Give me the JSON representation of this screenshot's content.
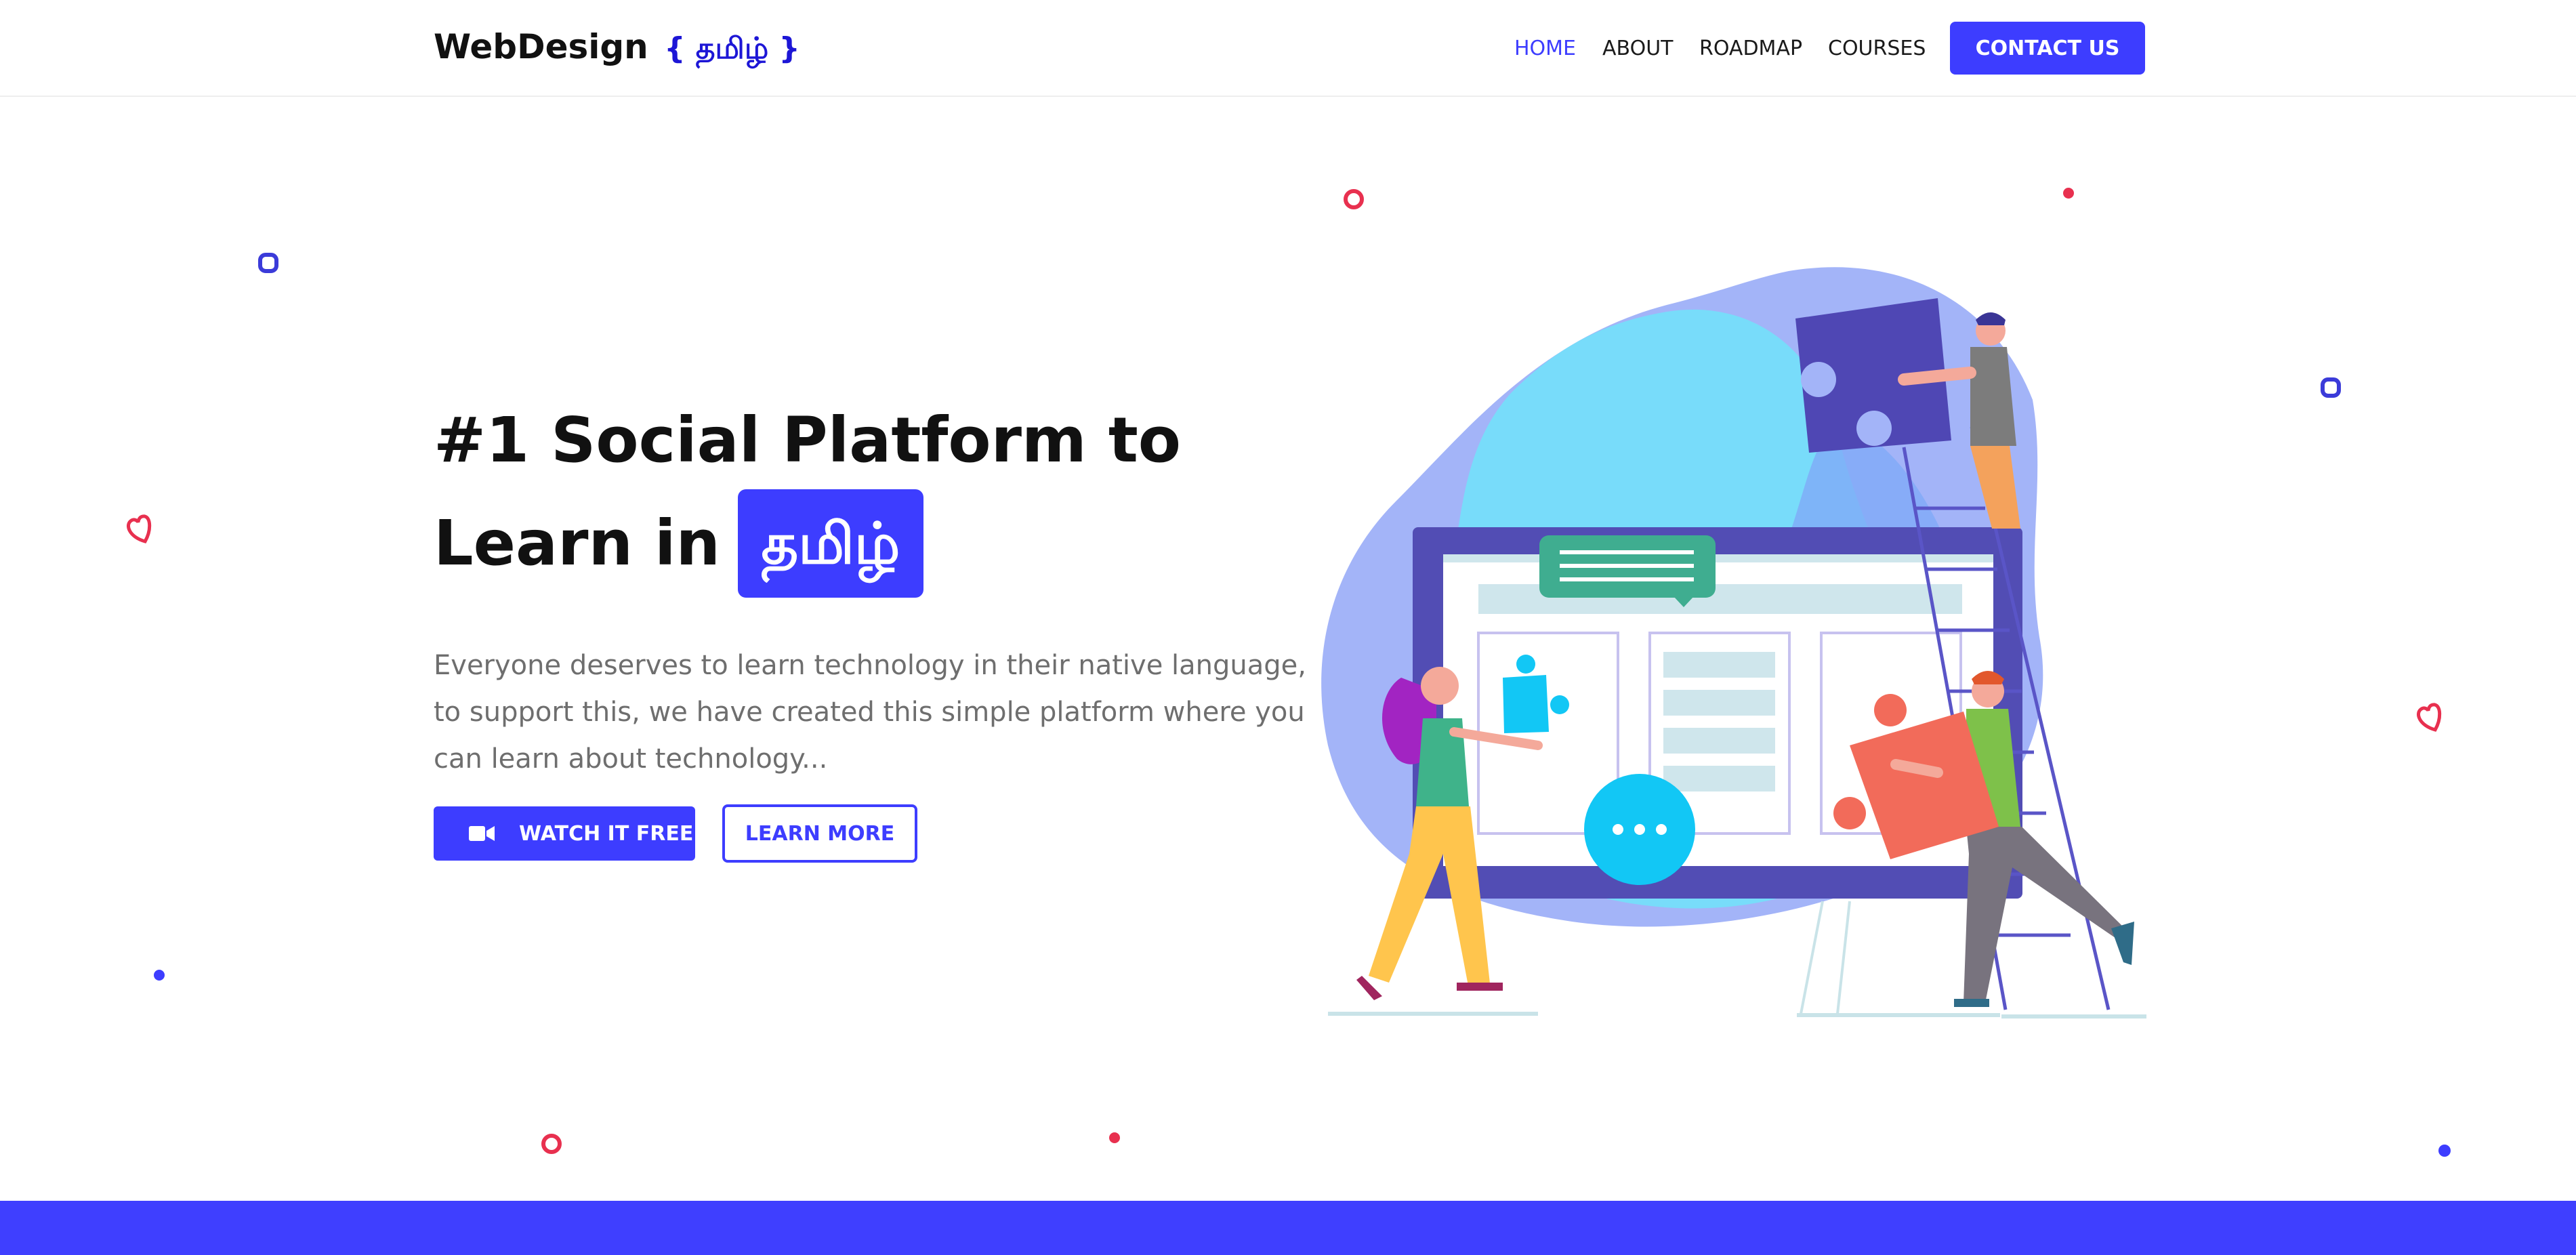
{
  "header": {
    "logo": {
      "text": "WebDesign",
      "tamil": "{ தமிழ் }"
    },
    "nav": [
      {
        "label": "HOME",
        "active": true
      },
      {
        "label": "ABOUT",
        "active": false
      },
      {
        "label": "ROADMAP",
        "active": false
      },
      {
        "label": "COURSES",
        "active": false
      }
    ],
    "contact_label": "CONTACT US"
  },
  "hero": {
    "title_line1": "#1 Social Platform to",
    "title_line2": "Learn in",
    "title_highlight": "தமிழ்",
    "description": "Everyone deserves to learn technology in their native language, to support this, we have created this simple platform where you can learn about technology...",
    "watch_label": "WATCH IT FREE",
    "learn_label": "LEARN MORE"
  },
  "icons": {
    "watch": "video-camera-icon",
    "illustration": "team-puzzle-illustration"
  },
  "colors": {
    "accent": "#3d3dff",
    "decor_red": "#e8304f",
    "decor_blue": "#3b3bd9",
    "text_muted": "#6e6e6e"
  }
}
